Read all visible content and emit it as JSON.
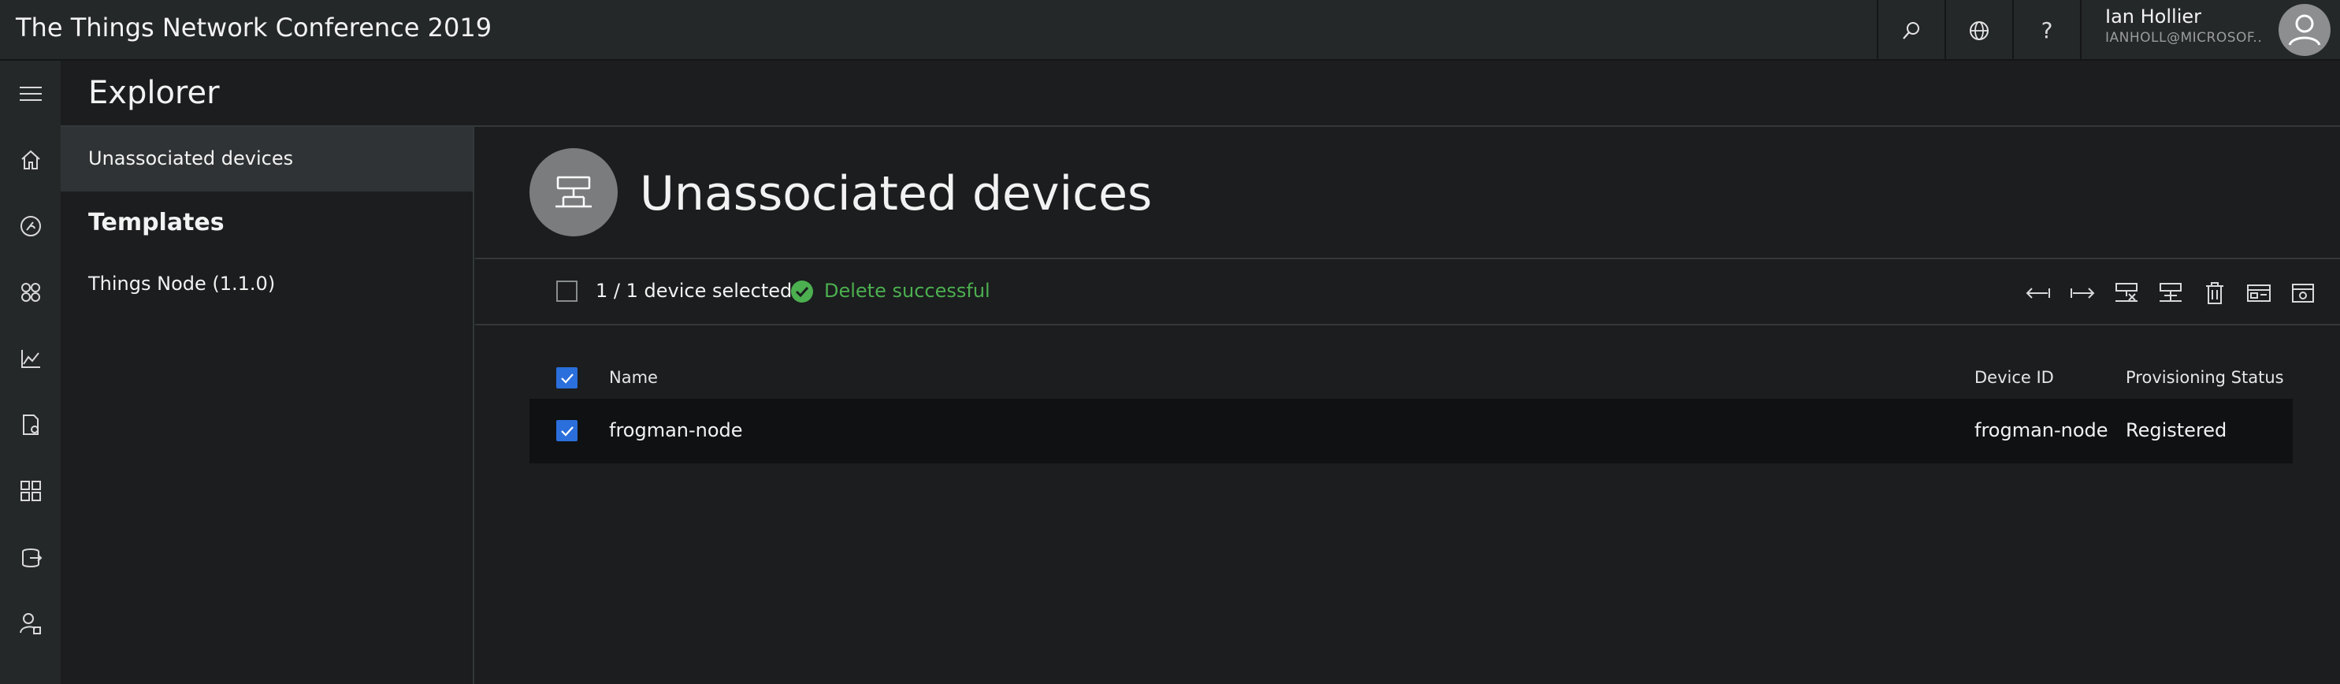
{
  "app": {
    "title": "The Things Network Conference 2019"
  },
  "user": {
    "name": "Ian Hollier",
    "email": "IANHOLL@MICROSOF..."
  },
  "topbar": {
    "help_label": "?"
  },
  "explorer": {
    "title": "Explorer",
    "active_item": "Unassociated devices",
    "templates_heading": "Templates",
    "templates": [
      "Things Node (1.1.0)"
    ]
  },
  "page": {
    "title": "Unassociated devices"
  },
  "toolbar": {
    "selected_count": "1 / 1 device selected",
    "status_message": "Delete successful"
  },
  "table": {
    "columns": [
      "Name",
      "Device ID",
      "Provisioning Status"
    ],
    "rows": [
      {
        "name": "frogman-node",
        "device_id": "frogman-node",
        "status": "Registered",
        "checked": true
      }
    ]
  },
  "colors": {
    "accent": "#2a6fdb",
    "success": "#4caf50",
    "background": "#1b1d1e",
    "chrome": "#252829"
  },
  "icons": {
    "rail": [
      "menu-icon",
      "home-icon",
      "dashboard-icon",
      "device-groups-icon",
      "analytics-icon",
      "jobs-icon",
      "templates-icon",
      "data-export-icon",
      "administration-icon"
    ],
    "toolbar": [
      "migrate-left-icon",
      "migrate-right-icon",
      "block-device-icon",
      "unblock-device-icon",
      "delete-icon",
      "connect-icon",
      "settings-icon"
    ]
  }
}
